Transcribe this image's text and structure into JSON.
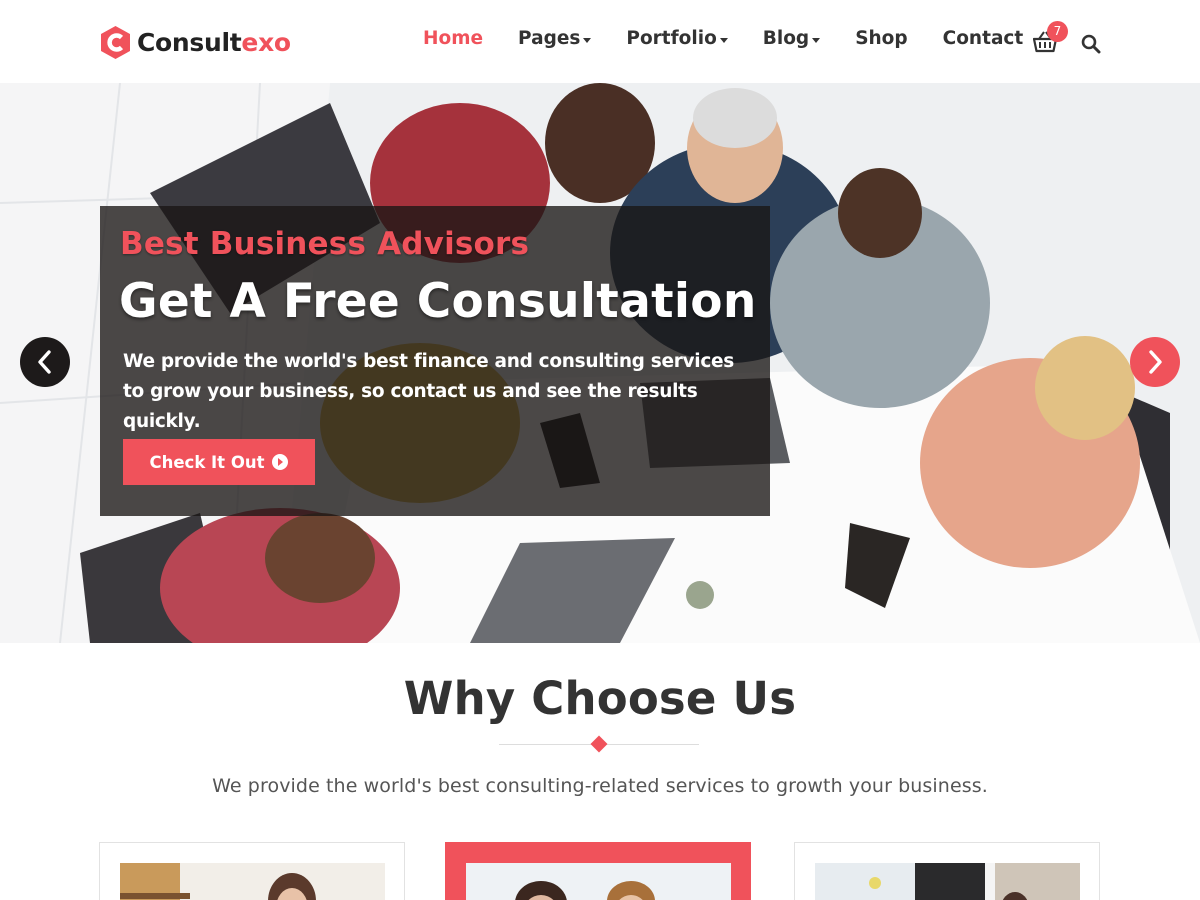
{
  "brand": {
    "name_main": "Consult",
    "name_accent": "exo",
    "accent_color": "#f0525b"
  },
  "nav": {
    "items": [
      {
        "label": "Home",
        "active": true,
        "dropdown": false
      },
      {
        "label": "Pages",
        "active": false,
        "dropdown": true
      },
      {
        "label": "Portfolio",
        "active": false,
        "dropdown": true
      },
      {
        "label": "Blog",
        "active": false,
        "dropdown": true
      },
      {
        "label": "Shop",
        "active": false,
        "dropdown": false
      },
      {
        "label": "Contact",
        "active": false,
        "dropdown": false
      }
    ],
    "cart_icon": "basket-icon",
    "cart_count": "7",
    "search_icon": "search-icon"
  },
  "hero": {
    "kicker": "Best Business Advisors",
    "title": "Get A Free Consultation",
    "description": "We provide the world's best finance and consulting services to grow your business, so contact us and see the results quickly.",
    "button_label": "Check It Out",
    "button_icon": "arrow-circle-right-icon",
    "prev_icon": "chevron-left-icon",
    "next_icon": "chevron-right-icon"
  },
  "why": {
    "title": "Why Choose Us",
    "subtitle": "We provide the world's best consulting-related services to growth your business."
  }
}
